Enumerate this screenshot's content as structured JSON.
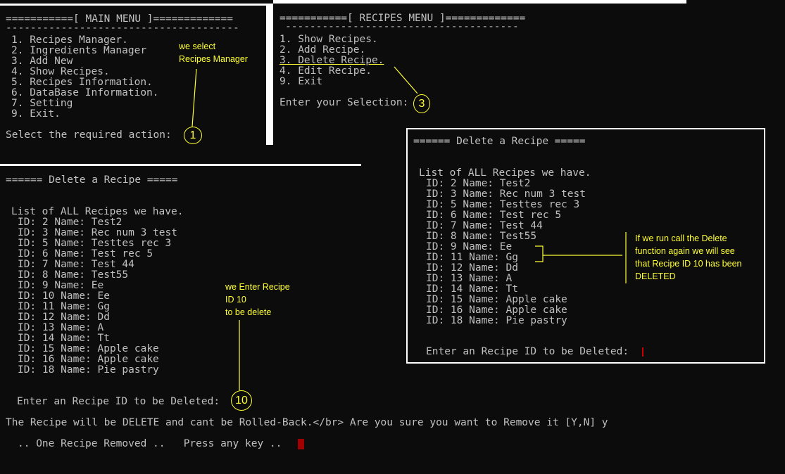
{
  "main_menu": {
    "title": "===========[ MAIN MENU ]=============",
    "rule": "--------------------------------------",
    "items": [
      "1. Recipes Manager.",
      "2. Ingredients Manager",
      "3. Add New",
      "4. Show Recipes.",
      "5. Recipes Information.",
      "6. DataBase Information.",
      "7. Setting",
      "9. Exit."
    ],
    "prompt": "Select the required action:",
    "answer": "1",
    "note": "we select\nRecipes Manager"
  },
  "recipes_menu": {
    "title": "===========[ RECIPES MENU ]=============",
    "rule": "--------------------------------------",
    "items": [
      "1. Show Recipes.",
      "2. Add Recipe.",
      "3. Delete Recipe.",
      "4. Edit Recipe.",
      "9. Exit"
    ],
    "prompt": "Enter your Selection:",
    "answer": "3"
  },
  "delete_left": {
    "title": "====== Delete a Recipe =====",
    "list_header": "List of ALL Recipes we have.",
    "rows": [
      "ID: 2 Name: Test2",
      "ID: 3 Name: Rec num 3 test",
      "ID: 5 Name: Testtes rec 3",
      "ID: 6 Name: Test rec 5",
      "ID: 7 Name: Test 44",
      "ID: 8 Name: Test55",
      "ID: 9 Name: Ee",
      "ID: 10 Name: Ee",
      "ID: 11 Name: Gg",
      "ID: 12 Name: Dd",
      "ID: 13 Name: A",
      "ID: 14 Name: Tt",
      "ID: 15 Name: Apple cake",
      "ID: 16 Name: Apple cake",
      "ID: 18 Name: Pie pastry"
    ],
    "prompt": "Enter an Recipe ID to be Deleted:",
    "answer": "10",
    "note": "we Enter Recipe\nID 10\nto be delete",
    "confirm_line": "The Recipe will be DELETE and cant be Rolled-Back.</br> Are you sure you want to Remove it [Y,N] y",
    "removed_line": ".. One Recipe Removed ..   Press any key .."
  },
  "delete_right": {
    "title": "====== Delete a Recipe =====",
    "list_header": "List of ALL Recipes we have.",
    "rows": [
      "ID: 2 Name: Test2",
      "ID: 3 Name: Rec num 3 test",
      "ID: 5 Name: Testtes rec 3",
      "ID: 6 Name: Test rec 5",
      "ID: 7 Name: Test 44",
      "ID: 8 Name: Test55",
      "ID: 9 Name: Ee",
      "ID: 11 Name: Gg",
      "ID: 12 Name: Dd",
      "ID: 13 Name: A",
      "ID: 14 Name: Tt",
      "ID: 15 Name: Apple cake",
      "ID: 16 Name: Apple cake",
      "ID: 18 Name: Pie pastry"
    ],
    "prompt": "Enter an Recipe ID to be Deleted:",
    "note": "If we run call the Delete\nfunction again we will see\nthat Recipe ID 10 has been\nDELETED"
  },
  "colors": {
    "background": "#0c0c0c",
    "text": "#c0c0c0",
    "annotation": "#ffff33",
    "cursor": "#a00000",
    "border": "#ffffff"
  }
}
